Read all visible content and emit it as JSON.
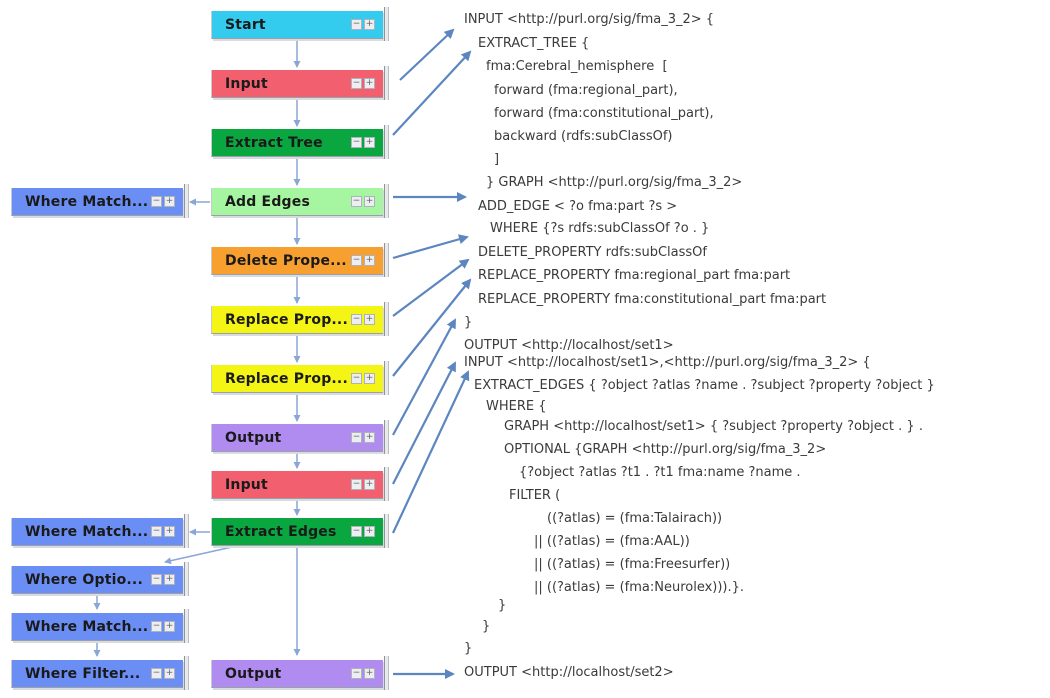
{
  "colors": {
    "start": "#33ccee",
    "input": "#f25f6e",
    "extract": "#0aa640",
    "add_edges": "#a6f5a0",
    "delete": "#f7a030",
    "replace": "#f5f515",
    "output": "#b08cf0",
    "where": "#6b8ef5",
    "arrow": "#5b86c0",
    "connector": "#8aa6d6"
  },
  "main_nodes": [
    {
      "label": "Start",
      "kind": "start"
    },
    {
      "label": "Input",
      "kind": "input"
    },
    {
      "label": "Extract Tree",
      "kind": "extract"
    },
    {
      "label": "Add Edges",
      "kind": "add_edges"
    },
    {
      "label": "Delete Prope...",
      "kind": "delete"
    },
    {
      "label": "Replace Prop...",
      "kind": "replace"
    },
    {
      "label": "Replace Prop...",
      "kind": "replace"
    },
    {
      "label": "Output",
      "kind": "output"
    },
    {
      "label": "Input",
      "kind": "input"
    },
    {
      "label": "Extract Edges",
      "kind": "extract"
    },
    {
      "label": "Output",
      "kind": "output"
    }
  ],
  "side_nodes": [
    {
      "label": "Where Match..."
    },
    {
      "label": "Where Match..."
    },
    {
      "label": "Where Optio..."
    },
    {
      "label": "Where Match..."
    },
    {
      "label": "Where Filter..."
    }
  ],
  "node_buttons": {
    "collapse": "−",
    "expand": "+"
  },
  "code_lines": [
    "INPUT <http://purl.org/sig/fma_3_2> {",
    "  EXTRACT_TREE {",
    "    fma:Cerebral_hemisphere  [",
    "      forward (fma:regional_part),",
    "      forward (fma:constitutional_part),",
    "      backward (rdfs:subClassOf)",
    "      ]",
    "    } GRAPH <http://purl.org/sig/fma_3_2>",
    "  ADD_EDGE < ?o fma:part ?s >",
    "    WHERE {?s rdfs:subClassOf ?o . }",
    "  DELETE_PROPERTY rdfs:subClassOf",
    "  REPLACE_PROPERTY fma:regional_part fma:part",
    "  REPLACE_PROPERTY fma:constitutional_part fma:part",
    "}",
    "OUTPUT <http://localhost/set1>",
    "INPUT <http://localhost/set1>,<http://purl.org/sig/fma_3_2> {",
    "  EXTRACT_EDGES { ?object ?atlas ?name . ?subject ?property ?object }",
    "    WHERE {",
    "      GRAPH <http://localhost/set1> { ?subject ?property ?object . } .",
    "      OPTIONAL {GRAPH <http://purl.org/sig/fma_3_2>",
    "        {?object ?atlas ?t1 . ?t1 fma:name ?name .",
    "       FILTER (",
    "                  ((?atlas) = (fma:Talairach))",
    "              || ((?atlas) = (fma:AAL))",
    "              || ((?atlas) = (fma:Freesurfer))",
    "              || ((?atlas) = (fma:Neurolex))).}.",
    "      }",
    "    }",
    "}",
    "OUTPUT <http://localhost/set2>"
  ]
}
